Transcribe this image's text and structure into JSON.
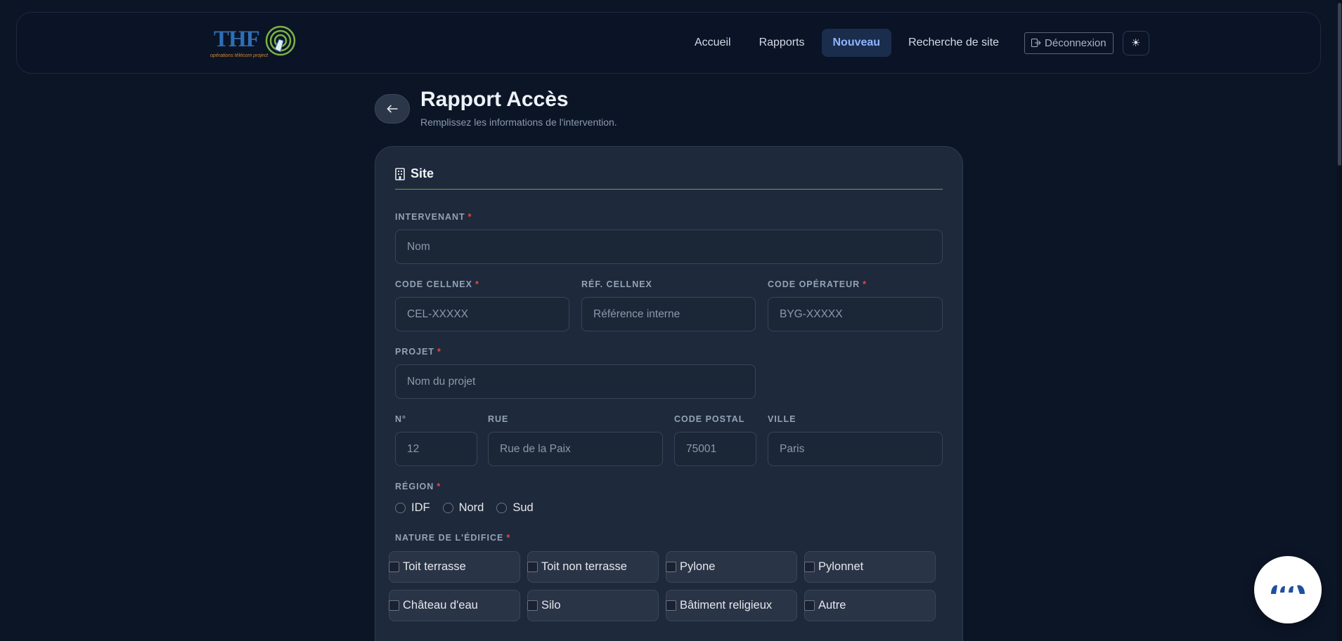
{
  "brand": {
    "logo_text": "THF",
    "tagline": "opérations télécom project"
  },
  "nav": {
    "items": [
      {
        "label": "Accueil"
      },
      {
        "label": "Rapports"
      },
      {
        "label": "Nouveau",
        "active": true
      },
      {
        "label": "Recherche de site"
      }
    ],
    "logout_label": "Déconnexion",
    "theme_icon": "☀"
  },
  "page": {
    "title": "Rapport Accès",
    "subtitle": "Remplissez les informations de l'intervention."
  },
  "section": {
    "title": "Site",
    "icon": "building-icon"
  },
  "fields": {
    "intervenant": {
      "label": "INTERVENANT",
      "required": "*",
      "placeholder": "Nom",
      "value": ""
    },
    "code_cellnex": {
      "label": "CODE CELLNEX",
      "required": "*",
      "placeholder": "CEL-XXXXX",
      "value": ""
    },
    "ref_cellnex": {
      "label": "RÉF. CELLNEX",
      "placeholder": "Référence interne",
      "value": ""
    },
    "code_operateur": {
      "label": "CODE OPÉRATEUR",
      "required": "*",
      "placeholder": "BYG-XXXXX",
      "value": ""
    },
    "projet": {
      "label": "PROJET",
      "required": "*",
      "placeholder": "Nom du projet",
      "value": ""
    },
    "numero": {
      "label": "N°",
      "placeholder": "12",
      "value": ""
    },
    "rue": {
      "label": "RUE",
      "placeholder": "Rue de la Paix",
      "value": ""
    },
    "code_postal": {
      "label": "CODE POSTAL",
      "placeholder": "75001",
      "value": ""
    },
    "ville": {
      "label": "VILLE",
      "placeholder": "Paris",
      "value": ""
    }
  },
  "region": {
    "label": "RÉGION",
    "required": "*",
    "options": [
      "IDF",
      "Nord",
      "Sud"
    ]
  },
  "nature": {
    "label": "NATURE DE L'ÉDIFICE",
    "required": "*",
    "options": [
      "Toit terrasse",
      "Toit non terrasse",
      "Pylone",
      "Pylonnet",
      "Château d'eau",
      "Silo",
      "Bâtiment religieux",
      "Autre"
    ]
  },
  "colors": {
    "accent": "#8fb5ff",
    "divider": "#7f9a3c",
    "required": "#ef4444"
  }
}
